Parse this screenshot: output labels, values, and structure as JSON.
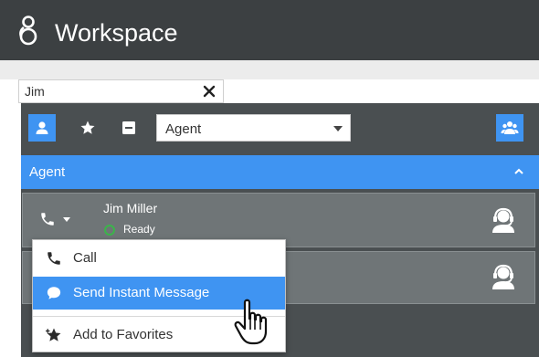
{
  "app": {
    "title": "Workspace",
    "logo_icon": "genesys-g-icon"
  },
  "search": {
    "value": "Jim",
    "clear_icon": "close-icon"
  },
  "toolbar": {
    "buttons": [
      {
        "id": "all-contacts",
        "icon": "person-icon",
        "active": true
      },
      {
        "id": "favorites",
        "icon": "star-icon",
        "active": false
      },
      {
        "id": "recent",
        "icon": "history-icon",
        "active": false
      }
    ],
    "type_select": {
      "selected": "Agent"
    },
    "team_icon": "team-communicator-icon"
  },
  "group": {
    "label": "Agent",
    "collapse_icon": "chevron-up-icon"
  },
  "contacts": [
    {
      "name": "Jim Miller",
      "status": "Ready",
      "status_color": "#3bb54a",
      "icon": "headset-icon"
    },
    {
      "name": "",
      "status": "",
      "icon": "headset-icon"
    }
  ],
  "context_menu": {
    "items": [
      {
        "label": "Call",
        "icon": "phone-icon",
        "hover": false
      },
      {
        "label": "Send Instant Message",
        "icon": "chat-bubble-icon",
        "hover": true
      },
      {
        "label": "Add to Favorites",
        "icon": "star-add-icon",
        "hover": false
      }
    ]
  },
  "colors": {
    "titlebar": "#3c4042",
    "panel": "#4a4f51",
    "accent": "#3f94f2",
    "row": "#6f7577",
    "ready": "#3bb54a"
  }
}
